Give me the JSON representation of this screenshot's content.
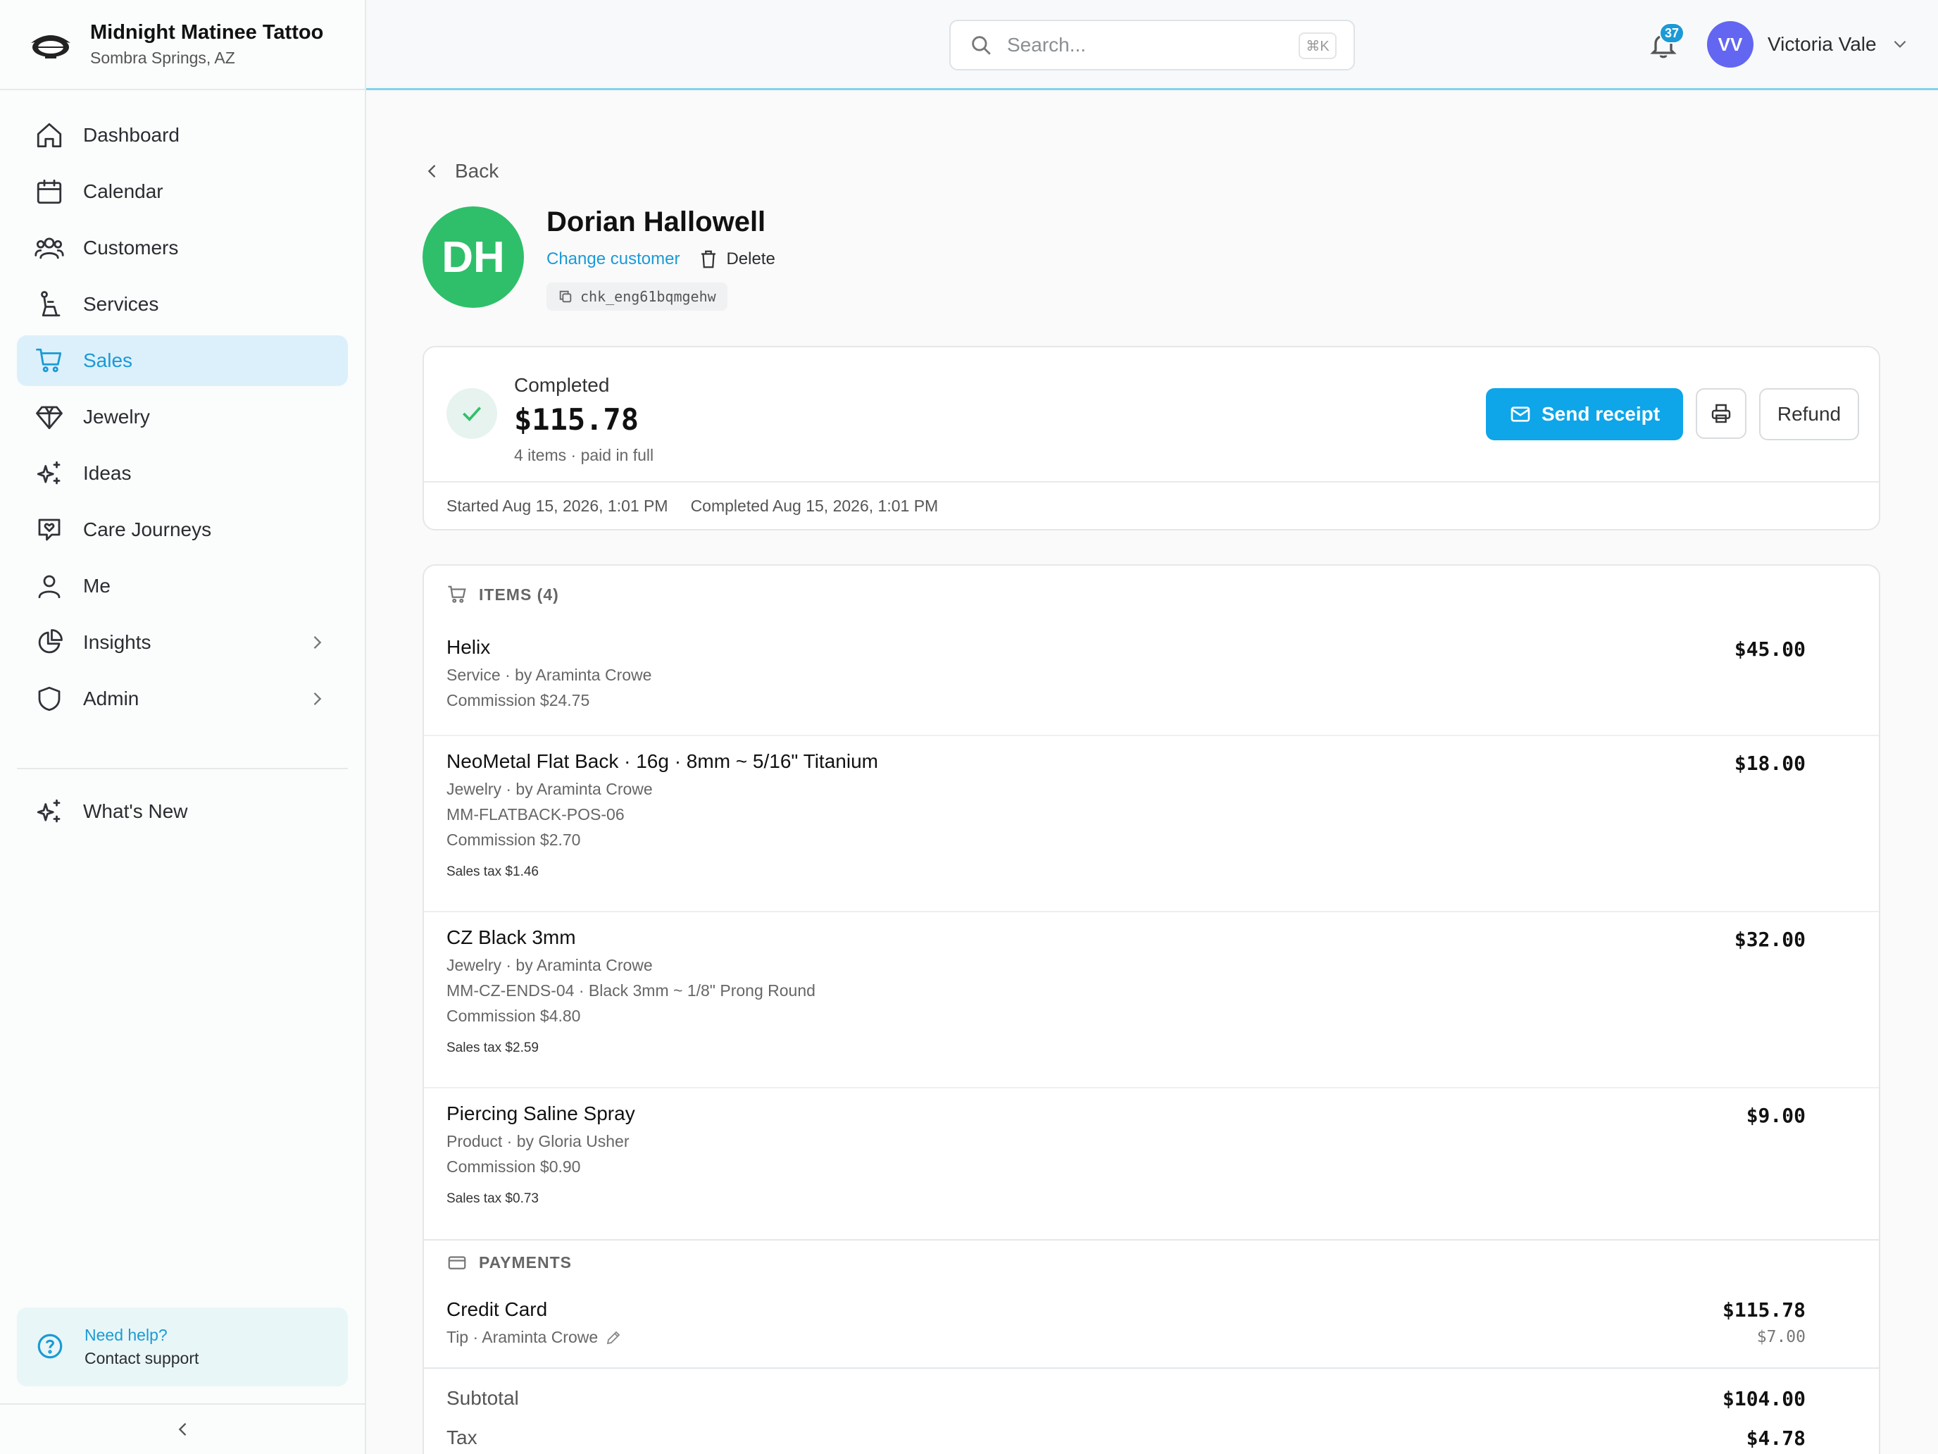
{
  "brand": {
    "name": "Midnight Matinee Tattoo",
    "location": "Sombra Springs, AZ",
    "logo_text": "MIDNIGHT MATINEE"
  },
  "sidebar": {
    "items": [
      {
        "label": "Dashboard",
        "icon": "home-icon"
      },
      {
        "label": "Calendar",
        "icon": "calendar-icon"
      },
      {
        "label": "Customers",
        "icon": "users-icon"
      },
      {
        "label": "Services",
        "icon": "services-icon"
      },
      {
        "label": "Sales",
        "icon": "cart-icon",
        "active": true
      },
      {
        "label": "Jewelry",
        "icon": "diamond-icon"
      },
      {
        "label": "Ideas",
        "icon": "sparkles-icon"
      },
      {
        "label": "Care Journeys",
        "icon": "care-icon"
      },
      {
        "label": "Me",
        "icon": "person-icon"
      },
      {
        "label": "Insights",
        "icon": "pie-chart-icon",
        "expandable": true
      },
      {
        "label": "Admin",
        "icon": "shield-icon",
        "expandable": true
      }
    ],
    "whats_new": "What's New",
    "help": {
      "title": "Need help?",
      "subtitle": "Contact support"
    }
  },
  "topbar": {
    "search_placeholder": "Search...",
    "shortcut": "⌘K",
    "notification_count": "37",
    "user": {
      "initials": "VV",
      "name": "Victoria Vale"
    }
  },
  "main": {
    "back_label": "Back",
    "customer": {
      "initials": "DH",
      "name": "Dorian Hallowell",
      "change_label": "Change customer",
      "delete_label": "Delete",
      "checkout_id": "chk_eng61bqmgehw"
    },
    "status": {
      "label": "Completed",
      "amount": "$115.78",
      "summary": "4 items · paid in full",
      "send_receipt": "Send receipt",
      "refund": "Refund",
      "started": "Started Aug 15, 2026, 1:01 PM",
      "completed": "Completed Aug 15, 2026, 1:01 PM"
    },
    "items_header": "ITEMS (4)",
    "items": [
      {
        "name": "Helix",
        "meta": "Service  ·  by Araminta Crowe",
        "sku": "",
        "commission": "Commission $24.75",
        "tax": "",
        "price": "$45.00"
      },
      {
        "name": "NeoMetal Flat Back · 16g · 8mm ~ 5/16\" Titanium",
        "meta": "Jewelry  ·  by Araminta Crowe",
        "sku": "MM-FLATBACK-POS-06",
        "commission": "Commission $2.70",
        "tax": "Sales tax $1.46",
        "price": "$18.00"
      },
      {
        "name": "CZ Black 3mm",
        "meta": "Jewelry  ·  by Araminta Crowe",
        "sku": "MM-CZ-ENDS-04 · Black 3mm ~ 1/8\" Prong Round",
        "commission": "Commission $4.80",
        "tax": "Sales tax $2.59",
        "price": "$32.00"
      },
      {
        "name": "Piercing Saline Spray",
        "meta": "Product  ·  by Gloria Usher",
        "sku": "",
        "commission": "Commission $0.90",
        "tax": "Sales tax $0.73",
        "price": "$9.00"
      }
    ],
    "payments_header": "PAYMENTS",
    "payment": {
      "method": "Credit Card",
      "tip": "Tip · Araminta Crowe",
      "amount": "$115.78",
      "tip_amount": "$7.00"
    },
    "totals": {
      "subtotal_label": "Subtotal",
      "subtotal": "$104.00",
      "tax_label": "Tax",
      "tax": "$4.78"
    }
  }
}
